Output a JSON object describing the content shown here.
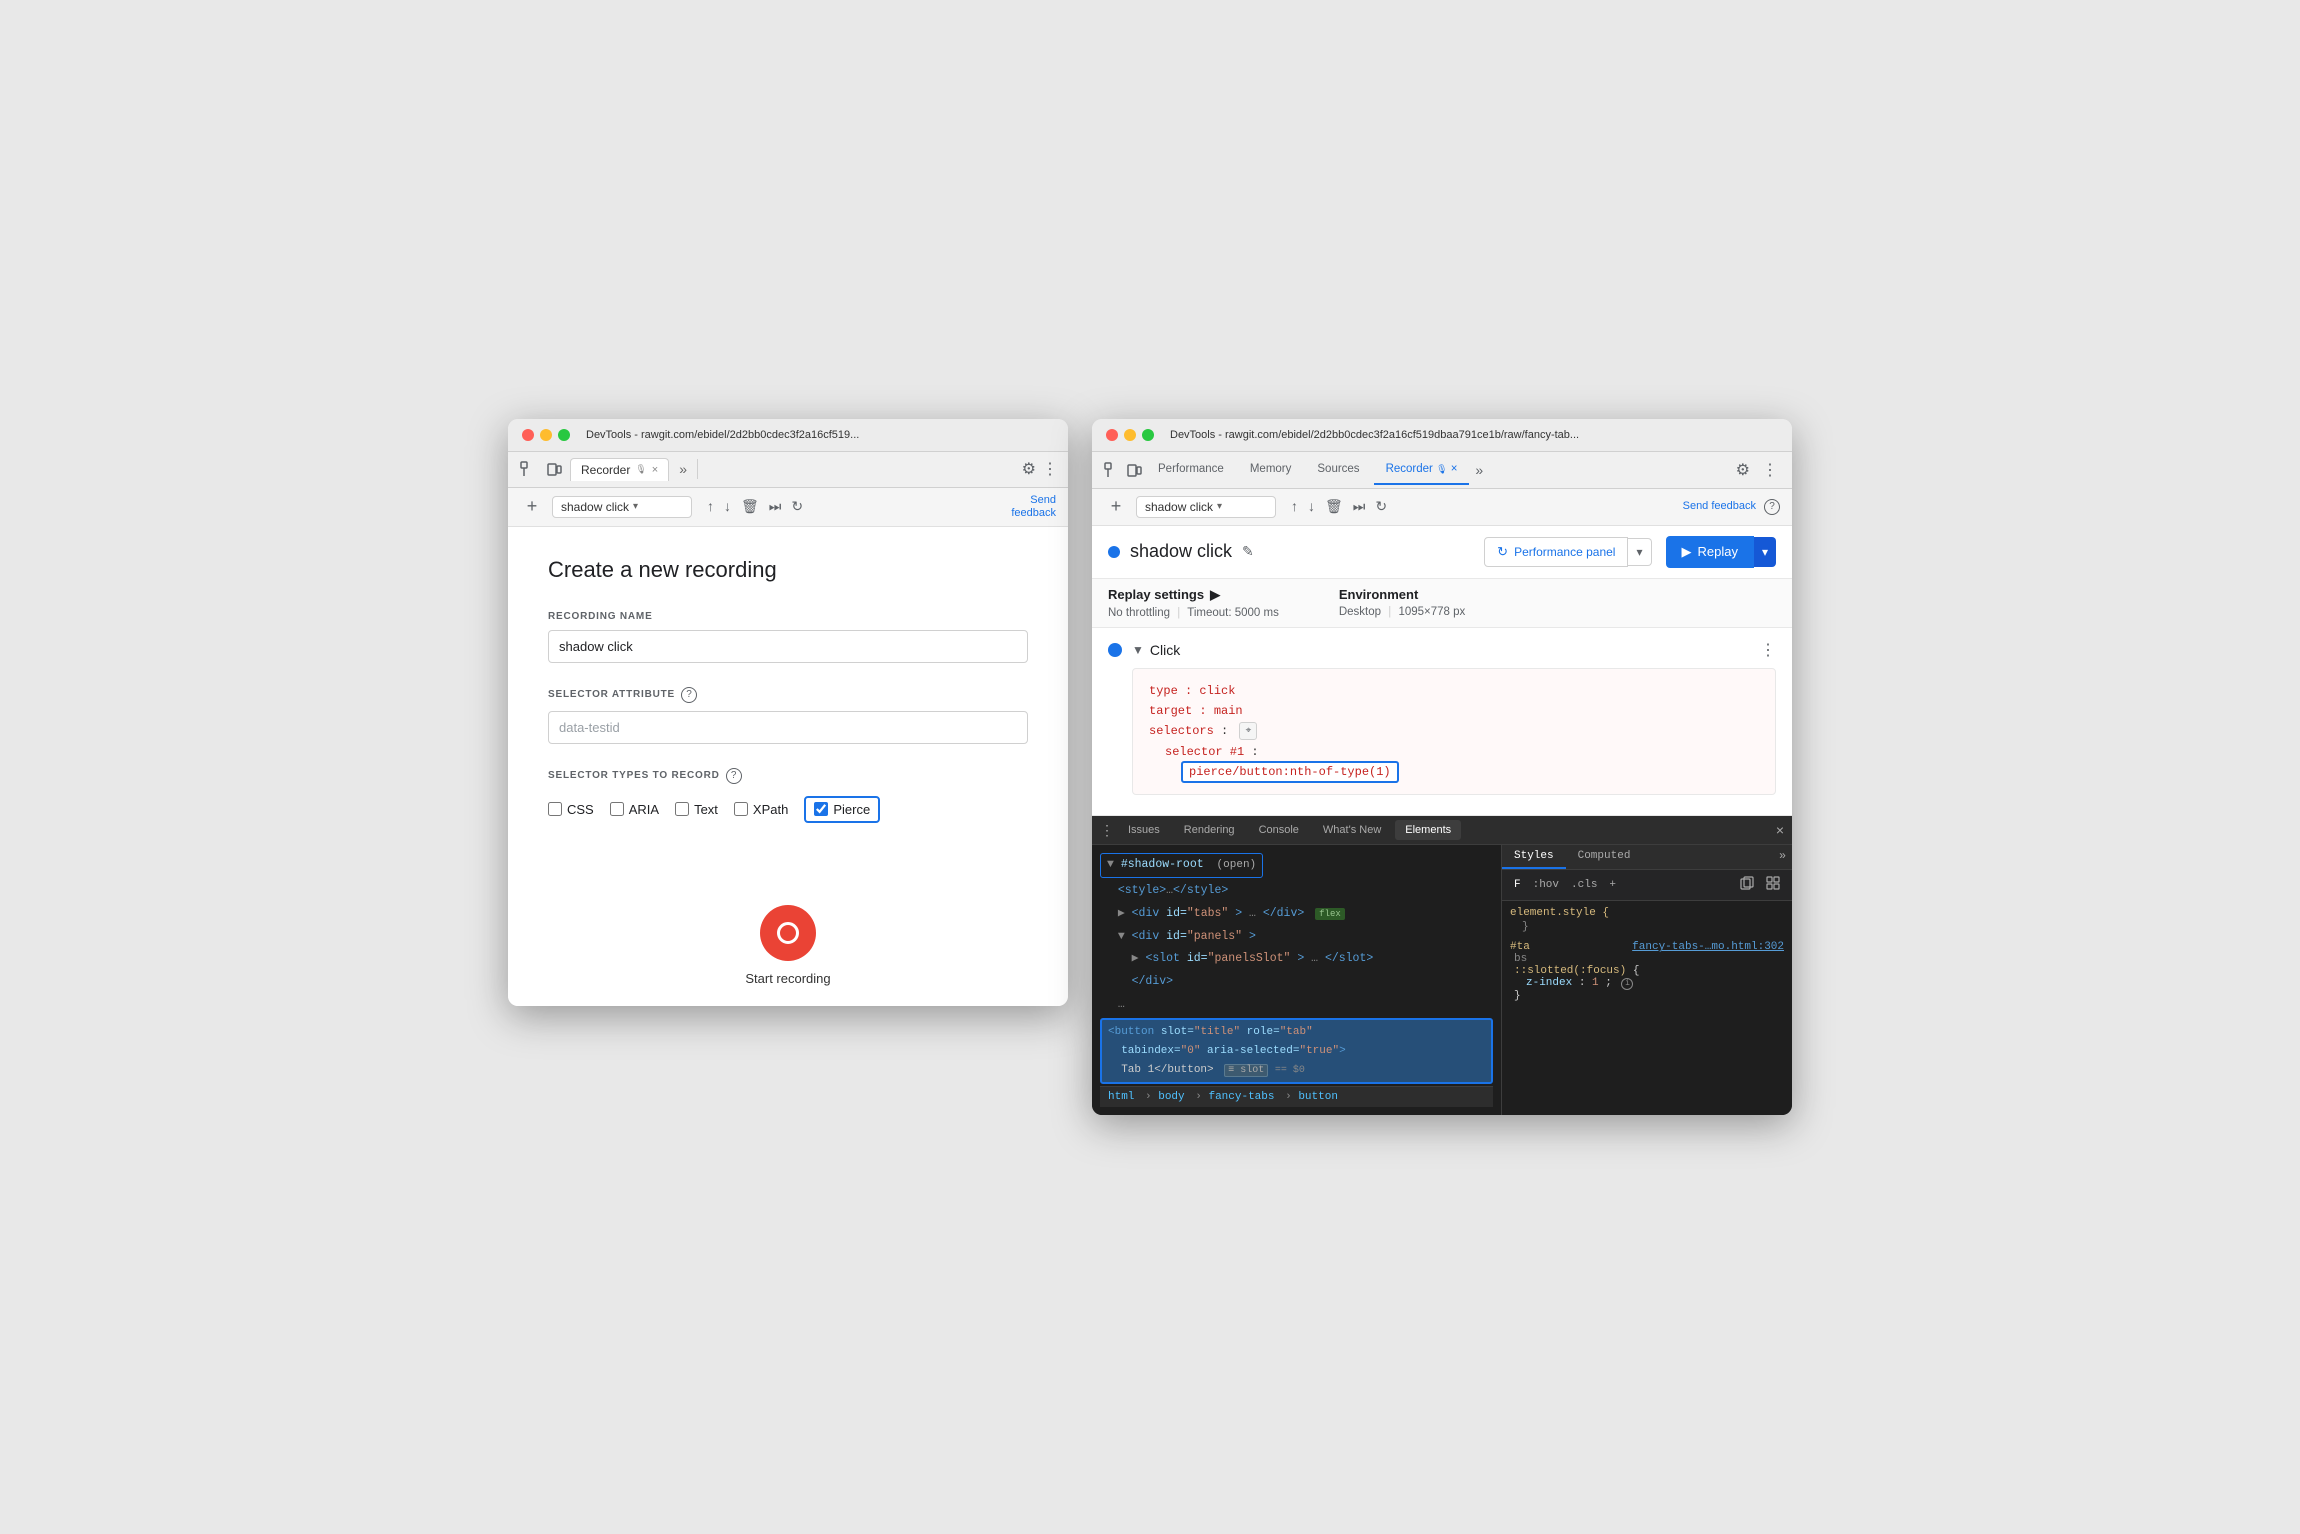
{
  "leftWindow": {
    "title": "DevTools - rawgit.com/ebidel/2d2bb0cdec3f2a16cf519...",
    "tabs": {
      "recorder": "Recorder",
      "close": "×",
      "more": "»"
    },
    "recordingRow": {
      "addLabel": "+",
      "selectorName": "shadow click",
      "sendFeedback": "Send\nfeedback"
    },
    "createSection": {
      "title": "Create a new recording",
      "recordingNameLabel": "RECORDING NAME",
      "recordingNameValue": "shadow click",
      "selectorAttributeLabel": "SELECTOR ATTRIBUTE",
      "selectorAttributePlaceholder": "data-testid",
      "selectorTypesLabel": "SELECTOR TYPES TO RECORD",
      "checkboxes": [
        {
          "label": "CSS",
          "checked": false
        },
        {
          "label": "ARIA",
          "checked": false
        },
        {
          "label": "Text",
          "checked": false
        },
        {
          "label": "XPath",
          "checked": false
        },
        {
          "label": "Pierce",
          "checked": true
        }
      ],
      "startRecordingLabel": "Start recording"
    }
  },
  "rightWindow": {
    "title": "DevTools - rawgit.com/ebidel/2d2bb0cdec3f2a16cf519dbaa791ce1b/raw/fancy-tab...",
    "tabs": [
      {
        "label": "Performance",
        "active": false
      },
      {
        "label": "Memory",
        "active": false
      },
      {
        "label": "Sources",
        "active": false
      },
      {
        "label": "Recorder",
        "active": true
      },
      {
        "label": "×",
        "close": true
      }
    ],
    "tabsMore": "»",
    "recordingRow": {
      "addLabel": "+",
      "selectorName": "shadow click",
      "sendFeedback": "Send feedback",
      "helpIcon": "?"
    },
    "recorderHeader": {
      "statusDot": true,
      "recordingName": "shadow click",
      "editIcon": "✎",
      "perfPanelBtn": "Performance panel",
      "perfPanelIcon": "↻",
      "replayBtn": "Replay",
      "replayIcon": "▶"
    },
    "replaySettings": {
      "title": "Replay settings",
      "titleArrow": "▶",
      "noThrottling": "No throttling",
      "separator1": "|",
      "timeout": "Timeout: 5000 ms",
      "envTitle": "Environment",
      "desktop": "Desktop",
      "separator2": "|",
      "resolution": "1095×778 px"
    },
    "step": {
      "expandArrow": "▼",
      "title": "Click",
      "moreIcon": "⋮",
      "code": {
        "type": "type: click",
        "target": "target: main",
        "selectors": "selectors:",
        "selectorNum": "selector #1:",
        "selectorVal": "pierce/button:nth-of-type(1)"
      }
    },
    "bottomPanel": {
      "tabs": [
        {
          "label": "Issues",
          "active": false
        },
        {
          "label": "Rendering",
          "active": false
        },
        {
          "label": "Console",
          "active": false
        },
        {
          "label": "What's New",
          "active": false
        },
        {
          "label": "Elements",
          "active": true
        }
      ],
      "close": "×",
      "htmlTree": [
        {
          "text": "▼ #shadow-root",
          "tag": "#shadow-root",
          "suffix": "(open)",
          "indent": 0,
          "highlight": false,
          "border": true
        },
        {
          "text": "  <style>…</style>",
          "indent": 1,
          "highlight": false
        },
        {
          "text": "  ▶ <div id=\"tabs\">…</div>",
          "indent": 1,
          "flex": true,
          "highlight": false
        },
        {
          "text": "  ▼ <div id=\"panels\">",
          "indent": 1,
          "highlight": false
        },
        {
          "text": "    ▶ <slot id=\"panelsSlot\">…</slot>",
          "indent": 2,
          "highlight": false
        },
        {
          "text": "    </div>",
          "indent": 2,
          "highlight": false
        },
        {
          "text": "  …",
          "indent": 1,
          "highlight": false
        },
        {
          "text": "<button slot=\"title\" role=\"tab\" tabindex=\"0\" aria-selected=\"true\">",
          "indent": 0,
          "highlight": true,
          "selected": true
        },
        {
          "text": "  Tab 1</button>",
          "indent": 1,
          "highlight": true,
          "sub": true
        },
        {
          "text": "  ≡ slot == $0",
          "indent": 2,
          "isSlot": true,
          "highlight": true
        }
      ],
      "breadcrumb": [
        "html",
        "body",
        "fancy-tabs",
        "button"
      ],
      "stylesPanel": {
        "tabs": [
          "Styles",
          "Computed"
        ],
        "moreIcon": "»",
        "filterLabel": "F",
        "hovLabel": ":hov",
        "clsLabel": ".cls",
        "addIcon": "+",
        "copyIcon": "⧉",
        "gridIcon": "⊞",
        "rules": [
          {
            "selector": "element.style {",
            "closing": "}",
            "properties": []
          },
          {
            "selector": "#ta  fancy-tabs-…mo.html:302",
            "selectorPart": "#ta",
            "sourcePart": "fancy-tabs-…mo.html:302",
            "closing": "bs",
            "subSelector": "::slotted(:focus) {",
            "props": [
              {
                "key": "z-index",
                "val": "1;"
              }
            ],
            "info": true
          }
        ]
      }
    }
  }
}
